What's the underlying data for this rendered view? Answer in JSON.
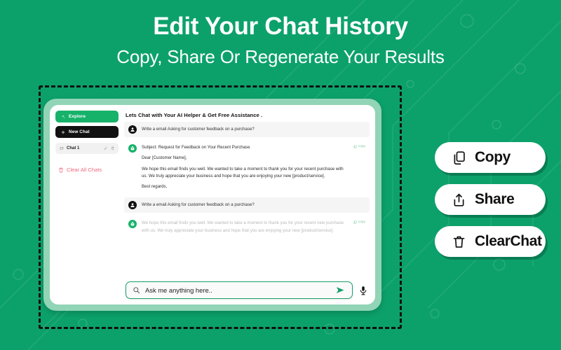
{
  "header": {
    "title": "Edit Your Chat History",
    "subtitle": "Copy, Share Or Regenerate Your Results"
  },
  "theme": {
    "background_green": "#0CA16B",
    "card_green": "#92D4B6",
    "accent_green": "#17B26A",
    "danger_pink": "#F2697C",
    "black": "#111111"
  },
  "app": {
    "sidebar": {
      "explore_label": "Explore",
      "new_chat_label": "New Chat",
      "chat_item": {
        "label": "Chat 1",
        "edit_icon": "pencil-icon",
        "delete_icon": "trash-icon",
        "leading_icon": "message-icon"
      },
      "clear_all_label": "Clear All Chats",
      "clear_all_icon": "trash-icon"
    },
    "chat": {
      "heading": "Lets Chat with Your AI Helper & Get Free Assistance .",
      "copy_chip_label": "copy",
      "messages": [
        {
          "role": "user",
          "avatar_icon": "user-avatar-icon",
          "lines": [
            "Write a email Asking for customer feedback on a purchase?"
          ]
        },
        {
          "role": "assistant",
          "avatar_icon": "bot-avatar-icon",
          "has_copy": true,
          "lines": [
            "Subject: Request for Feedback on Your Recent Purchase",
            "Dear [Customer Name],",
            "We hope this email finds you well. We wanted to take a moment to thank you for your recent purchase with us. We truly appreciate your business and hope that you are enjoying your new [product/service].",
            "Best regards,"
          ]
        },
        {
          "role": "user",
          "avatar_icon": "user-avatar-icon",
          "lines": [
            "Write a email Asking for customer feedback on a purchase?"
          ]
        },
        {
          "role": "assistant",
          "avatar_icon": "bot-avatar-icon",
          "has_copy": true,
          "lines": [
            "We hope this email finds you well. We wanted to take a moment to thank you for your recent new purchase with us. We truly appreciate your business and hope that you are enjoying your new [product/service]."
          ]
        }
      ]
    },
    "composer": {
      "placeholder": "Ask me anything here..",
      "search_icon": "search-icon",
      "send_icon": "send-icon",
      "mic_icon": "microphone-icon"
    }
  },
  "actions": [
    {
      "label": "Copy",
      "icon": "copy-icon"
    },
    {
      "label": "Share",
      "icon": "share-icon"
    },
    {
      "label": "ClearChat",
      "icon": "trash-icon"
    }
  ]
}
